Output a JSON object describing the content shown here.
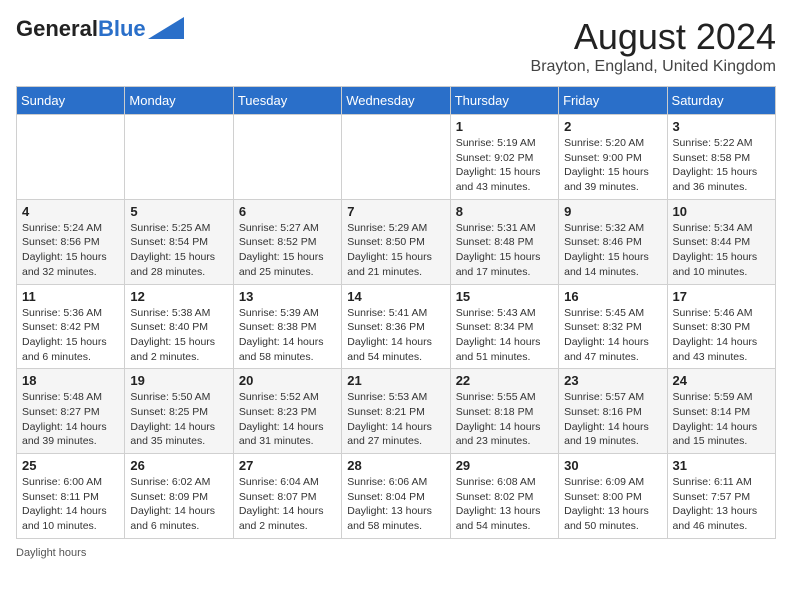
{
  "header": {
    "logo_general": "General",
    "logo_blue": "Blue",
    "month_year": "August 2024",
    "location": "Brayton, England, United Kingdom"
  },
  "days_of_week": [
    "Sunday",
    "Monday",
    "Tuesday",
    "Wednesday",
    "Thursday",
    "Friday",
    "Saturday"
  ],
  "weeks": [
    [
      {
        "day": "",
        "sunrise": "",
        "sunset": "",
        "daylight": ""
      },
      {
        "day": "",
        "sunrise": "",
        "sunset": "",
        "daylight": ""
      },
      {
        "day": "",
        "sunrise": "",
        "sunset": "",
        "daylight": ""
      },
      {
        "day": "",
        "sunrise": "",
        "sunset": "",
        "daylight": ""
      },
      {
        "day": "1",
        "sunrise": "5:19 AM",
        "sunset": "9:02 PM",
        "daylight": "15 hours and 43 minutes."
      },
      {
        "day": "2",
        "sunrise": "5:20 AM",
        "sunset": "9:00 PM",
        "daylight": "15 hours and 39 minutes."
      },
      {
        "day": "3",
        "sunrise": "5:22 AM",
        "sunset": "8:58 PM",
        "daylight": "15 hours and 36 minutes."
      }
    ],
    [
      {
        "day": "4",
        "sunrise": "5:24 AM",
        "sunset": "8:56 PM",
        "daylight": "15 hours and 32 minutes."
      },
      {
        "day": "5",
        "sunrise": "5:25 AM",
        "sunset": "8:54 PM",
        "daylight": "15 hours and 28 minutes."
      },
      {
        "day": "6",
        "sunrise": "5:27 AM",
        "sunset": "8:52 PM",
        "daylight": "15 hours and 25 minutes."
      },
      {
        "day": "7",
        "sunrise": "5:29 AM",
        "sunset": "8:50 PM",
        "daylight": "15 hours and 21 minutes."
      },
      {
        "day": "8",
        "sunrise": "5:31 AM",
        "sunset": "8:48 PM",
        "daylight": "15 hours and 17 minutes."
      },
      {
        "day": "9",
        "sunrise": "5:32 AM",
        "sunset": "8:46 PM",
        "daylight": "15 hours and 14 minutes."
      },
      {
        "day": "10",
        "sunrise": "5:34 AM",
        "sunset": "8:44 PM",
        "daylight": "15 hours and 10 minutes."
      }
    ],
    [
      {
        "day": "11",
        "sunrise": "5:36 AM",
        "sunset": "8:42 PM",
        "daylight": "15 hours and 6 minutes."
      },
      {
        "day": "12",
        "sunrise": "5:38 AM",
        "sunset": "8:40 PM",
        "daylight": "15 hours and 2 minutes."
      },
      {
        "day": "13",
        "sunrise": "5:39 AM",
        "sunset": "8:38 PM",
        "daylight": "14 hours and 58 minutes."
      },
      {
        "day": "14",
        "sunrise": "5:41 AM",
        "sunset": "8:36 PM",
        "daylight": "14 hours and 54 minutes."
      },
      {
        "day": "15",
        "sunrise": "5:43 AM",
        "sunset": "8:34 PM",
        "daylight": "14 hours and 51 minutes."
      },
      {
        "day": "16",
        "sunrise": "5:45 AM",
        "sunset": "8:32 PM",
        "daylight": "14 hours and 47 minutes."
      },
      {
        "day": "17",
        "sunrise": "5:46 AM",
        "sunset": "8:30 PM",
        "daylight": "14 hours and 43 minutes."
      }
    ],
    [
      {
        "day": "18",
        "sunrise": "5:48 AM",
        "sunset": "8:27 PM",
        "daylight": "14 hours and 39 minutes."
      },
      {
        "day": "19",
        "sunrise": "5:50 AM",
        "sunset": "8:25 PM",
        "daylight": "14 hours and 35 minutes."
      },
      {
        "day": "20",
        "sunrise": "5:52 AM",
        "sunset": "8:23 PM",
        "daylight": "14 hours and 31 minutes."
      },
      {
        "day": "21",
        "sunrise": "5:53 AM",
        "sunset": "8:21 PM",
        "daylight": "14 hours and 27 minutes."
      },
      {
        "day": "22",
        "sunrise": "5:55 AM",
        "sunset": "8:18 PM",
        "daylight": "14 hours and 23 minutes."
      },
      {
        "day": "23",
        "sunrise": "5:57 AM",
        "sunset": "8:16 PM",
        "daylight": "14 hours and 19 minutes."
      },
      {
        "day": "24",
        "sunrise": "5:59 AM",
        "sunset": "8:14 PM",
        "daylight": "14 hours and 15 minutes."
      }
    ],
    [
      {
        "day": "25",
        "sunrise": "6:00 AM",
        "sunset": "8:11 PM",
        "daylight": "14 hours and 10 minutes."
      },
      {
        "day": "26",
        "sunrise": "6:02 AM",
        "sunset": "8:09 PM",
        "daylight": "14 hours and 6 minutes."
      },
      {
        "day": "27",
        "sunrise": "6:04 AM",
        "sunset": "8:07 PM",
        "daylight": "14 hours and 2 minutes."
      },
      {
        "day": "28",
        "sunrise": "6:06 AM",
        "sunset": "8:04 PM",
        "daylight": "13 hours and 58 minutes."
      },
      {
        "day": "29",
        "sunrise": "6:08 AM",
        "sunset": "8:02 PM",
        "daylight": "13 hours and 54 minutes."
      },
      {
        "day": "30",
        "sunrise": "6:09 AM",
        "sunset": "8:00 PM",
        "daylight": "13 hours and 50 minutes."
      },
      {
        "day": "31",
        "sunrise": "6:11 AM",
        "sunset": "7:57 PM",
        "daylight": "13 hours and 46 minutes."
      }
    ]
  ],
  "footer": {
    "daylight_hours_label": "Daylight hours"
  },
  "labels": {
    "sunrise_prefix": "Sunrise: ",
    "sunset_prefix": "Sunset: ",
    "daylight_prefix": "Daylight: "
  }
}
